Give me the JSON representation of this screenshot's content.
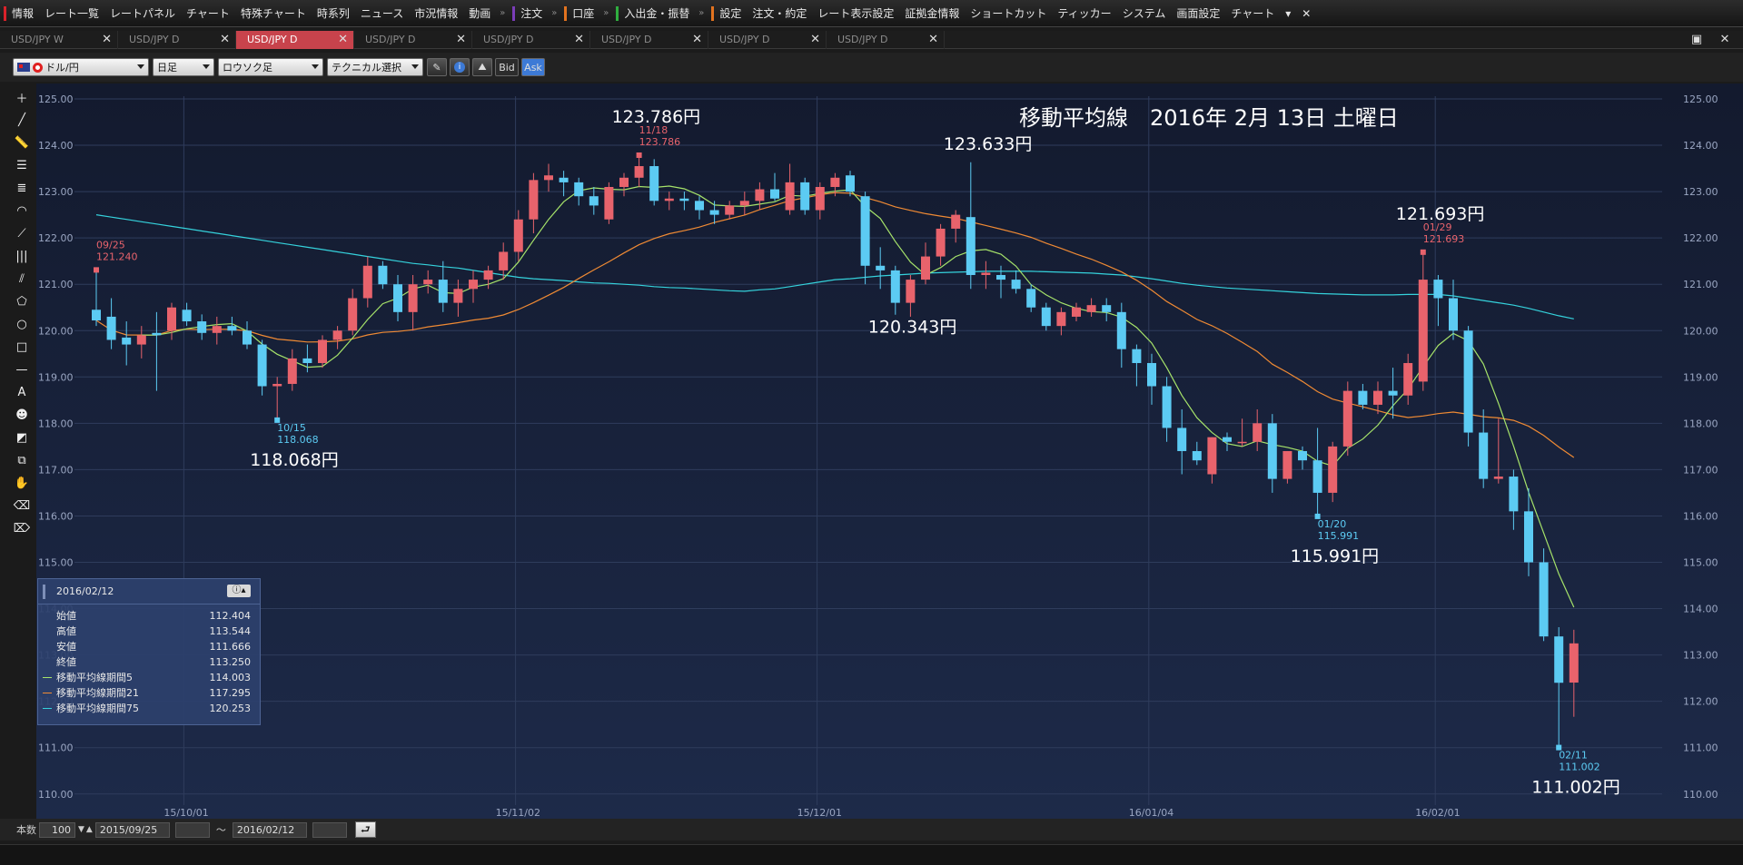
{
  "menu": {
    "groups": [
      {
        "mark": "#d9222a",
        "items": [
          "情報",
          "レート一覧",
          "レートパネル",
          "チャート",
          "特殊チャート",
          "時系列",
          "ニュース",
          "市況情報",
          "動画"
        ]
      },
      {
        "mark": "#7a3db8",
        "items": [
          "注文"
        ]
      },
      {
        "mark": "#e2731f",
        "items": [
          "口座"
        ]
      },
      {
        "mark": "#2fae3f",
        "items": [
          "入出金・振替"
        ]
      },
      {
        "mark": "#e2731f",
        "items": [
          "設定",
          "注文・約定",
          "レート表示設定",
          "証拠金情報",
          "ショートカット",
          "ティッカー",
          "システム",
          "画面設定",
          "チャート"
        ]
      }
    ],
    "more_label": "▾",
    "close_label": "✕"
  },
  "tabs": [
    {
      "label": "USD/JPY W",
      "active": false
    },
    {
      "label": "USD/JPY D",
      "active": false
    },
    {
      "label": "USD/JPY D",
      "active": true
    },
    {
      "label": "USD/JPY D",
      "active": false
    },
    {
      "label": "USD/JPY D",
      "active": false
    },
    {
      "label": "USD/JPY D",
      "active": false
    },
    {
      "label": "USD/JPY D",
      "active": false
    },
    {
      "label": "USD/JPY D",
      "active": false
    }
  ],
  "toolbar": {
    "pair": "ドル/円",
    "timeframe": "日足",
    "chart_style": "ロウソク足",
    "technical": "テクニカル選択",
    "bid_label": "Bid",
    "ask_label": "Ask"
  },
  "footer": {
    "count_label": "本数",
    "count_value": "100",
    "date_from": "2015/09/25",
    "tilde": "～",
    "date_to": "2016/02/12",
    "go_label": "⮐"
  },
  "ohlc": {
    "date": "2016/02/12",
    "rows": [
      {
        "label": "始値",
        "value": "112.404",
        "swatch": ""
      },
      {
        "label": "高値",
        "value": "113.544",
        "swatch": ""
      },
      {
        "label": "安値",
        "value": "111.666",
        "swatch": ""
      },
      {
        "label": "終値",
        "value": "113.250",
        "swatch": ""
      },
      {
        "label": "移動平均線期間5",
        "value": "114.003",
        "swatch": "#a6e36a"
      },
      {
        "label": "移動平均線期間21",
        "value": "117.295",
        "swatch": "#ef8a34"
      },
      {
        "label": "移動平均線期間75",
        "value": "120.253",
        "swatch": "#35d2dc"
      }
    ]
  },
  "chart_data": {
    "type": "candlestick",
    "title": "移動平均線　2016年 2月 13日 土曜日",
    "ylim": [
      110.0,
      125.0
    ],
    "yticks": [
      "125.00",
      "124.00",
      "123.00",
      "122.00",
      "121.00",
      "120.00",
      "119.00",
      "118.00",
      "117.00",
      "116.00",
      "115.00",
      "114.00",
      "113.00",
      "112.00",
      "111.00",
      "110.00"
    ],
    "xticks": [
      {
        "label": "15/10/01",
        "index": 4
      },
      {
        "label": "15/11/02",
        "index": 26
      },
      {
        "label": "15/12/01",
        "index": 46
      },
      {
        "label": "16/01/04",
        "index": 68
      },
      {
        "label": "16/02/01",
        "index": 87
      }
    ],
    "colors": {
      "up": "#e8636c",
      "down": "#5ccbf3",
      "ma5": "#a6e36a",
      "ma21": "#ef8a34",
      "ma75": "#35d2dc"
    },
    "candles": [
      [
        120.45,
        121.31,
        120.1,
        120.22
      ],
      [
        120.3,
        120.7,
        119.6,
        119.8
      ],
      [
        119.85,
        120.2,
        119.25,
        119.7
      ],
      [
        119.7,
        120.1,
        119.4,
        119.9
      ],
      [
        119.95,
        120.4,
        118.7,
        119.9
      ],
      [
        120.0,
        120.6,
        119.8,
        120.5
      ],
      [
        120.45,
        120.6,
        120.1,
        120.2
      ],
      [
        120.2,
        120.35,
        119.8,
        119.95
      ],
      [
        119.95,
        120.3,
        119.7,
        120.1
      ],
      [
        120.1,
        120.3,
        119.9,
        120.0
      ],
      [
        120.0,
        120.2,
        119.6,
        119.7
      ],
      [
        119.7,
        119.8,
        118.6,
        118.8
      ],
      [
        118.8,
        119.0,
        118.068,
        118.85
      ],
      [
        118.85,
        119.6,
        118.7,
        119.4
      ],
      [
        119.4,
        119.7,
        119.1,
        119.3
      ],
      [
        119.3,
        119.9,
        119.2,
        119.8
      ],
      [
        119.8,
        120.1,
        119.6,
        120.0
      ],
      [
        120.0,
        120.9,
        119.9,
        120.7
      ],
      [
        120.7,
        121.6,
        120.5,
        121.4
      ],
      [
        121.4,
        121.5,
        120.9,
        121.0
      ],
      [
        121.0,
        121.2,
        120.2,
        120.4
      ],
      [
        120.4,
        121.2,
        120.0,
        121.0
      ],
      [
        121.0,
        121.3,
        120.8,
        121.1
      ],
      [
        121.1,
        121.5,
        120.4,
        120.6
      ],
      [
        120.6,
        121.1,
        120.3,
        120.9
      ],
      [
        120.9,
        121.3,
        120.6,
        121.1
      ],
      [
        121.1,
        121.4,
        120.9,
        121.3
      ],
      [
        121.3,
        121.9,
        121.1,
        121.7
      ],
      [
        121.7,
        122.6,
        121.5,
        122.4
      ],
      [
        122.4,
        123.4,
        122.1,
        123.25
      ],
      [
        123.25,
        123.6,
        123.0,
        123.35
      ],
      [
        123.3,
        123.45,
        122.9,
        123.2
      ],
      [
        123.2,
        123.3,
        122.7,
        122.9
      ],
      [
        122.9,
        123.1,
        122.5,
        122.7
      ],
      [
        122.4,
        123.2,
        122.3,
        123.1
      ],
      [
        123.1,
        123.4,
        122.9,
        123.3
      ],
      [
        123.3,
        123.786,
        123.1,
        123.55
      ],
      [
        123.55,
        123.7,
        122.7,
        122.8
      ],
      [
        122.8,
        123.0,
        122.6,
        122.85
      ],
      [
        122.85,
        123.0,
        122.6,
        122.8
      ],
      [
        122.8,
        122.9,
        122.4,
        122.6
      ],
      [
        122.6,
        122.8,
        122.3,
        122.5
      ],
      [
        122.5,
        122.8,
        122.4,
        122.7
      ],
      [
        122.7,
        123.0,
        122.5,
        122.8
      ],
      [
        122.8,
        123.2,
        122.6,
        123.05
      ],
      [
        123.05,
        123.4,
        122.8,
        122.85
      ],
      [
        122.6,
        123.6,
        122.5,
        123.2
      ],
      [
        123.2,
        123.3,
        122.5,
        122.6
      ],
      [
        122.6,
        123.2,
        122.4,
        123.1
      ],
      [
        123.1,
        123.4,
        122.9,
        123.3
      ],
      [
        123.35,
        123.45,
        122.9,
        123.0
      ],
      [
        122.9,
        123.0,
        121.0,
        121.4
      ],
      [
        121.4,
        121.8,
        120.9,
        121.3
      ],
      [
        121.3,
        121.4,
        120.343,
        120.6
      ],
      [
        120.6,
        121.2,
        120.3,
        121.1
      ],
      [
        121.1,
        121.9,
        121.0,
        121.6
      ],
      [
        121.6,
        122.3,
        121.4,
        122.2
      ],
      [
        122.2,
        122.6,
        121.9,
        122.5
      ],
      [
        122.45,
        123.633,
        120.9,
        121.2
      ],
      [
        121.2,
        121.5,
        120.9,
        121.25
      ],
      [
        121.2,
        121.4,
        120.7,
        121.1
      ],
      [
        121.1,
        121.3,
        120.8,
        120.9
      ],
      [
        120.9,
        121.0,
        120.4,
        120.5
      ],
      [
        120.5,
        120.6,
        120.0,
        120.1
      ],
      [
        120.1,
        120.5,
        119.9,
        120.4
      ],
      [
        120.3,
        120.6,
        120.2,
        120.5
      ],
      [
        120.4,
        120.7,
        120.3,
        120.55
      ],
      [
        120.55,
        120.7,
        120.2,
        120.4
      ],
      [
        120.4,
        120.6,
        119.2,
        119.6
      ],
      [
        119.6,
        119.7,
        118.8,
        119.3
      ],
      [
        119.3,
        119.5,
        118.4,
        118.8
      ],
      [
        118.8,
        119.0,
        117.6,
        117.9
      ],
      [
        117.9,
        118.3,
        116.9,
        117.4
      ],
      [
        117.4,
        117.6,
        117.1,
        117.2
      ],
      [
        116.9,
        117.7,
        116.7,
        117.7
      ],
      [
        117.7,
        117.8,
        117.4,
        117.6
      ],
      [
        117.6,
        118.1,
        117.5,
        117.6
      ],
      [
        117.6,
        118.3,
        117.4,
        118.0
      ],
      [
        118.0,
        118.2,
        116.5,
        116.8
      ],
      [
        116.8,
        117.4,
        116.7,
        117.4
      ],
      [
        117.4,
        117.5,
        117.0,
        117.2
      ],
      [
        117.2,
        117.9,
        115.991,
        116.5
      ],
      [
        116.5,
        117.6,
        116.3,
        117.5
      ],
      [
        117.5,
        118.9,
        117.3,
        118.7
      ],
      [
        118.7,
        118.85,
        118.3,
        118.4
      ],
      [
        118.4,
        118.9,
        118.2,
        118.7
      ],
      [
        118.7,
        119.2,
        118.1,
        118.6
      ],
      [
        118.6,
        119.5,
        118.4,
        119.3
      ],
      [
        118.9,
        121.693,
        118.7,
        121.1
      ],
      [
        121.1,
        121.2,
        120.1,
        120.7
      ],
      [
        120.7,
        121.1,
        119.8,
        120.0
      ],
      [
        120.0,
        120.1,
        117.5,
        117.8
      ],
      [
        117.8,
        118.3,
        116.6,
        116.8
      ],
      [
        116.8,
        118.1,
        116.7,
        116.85
      ],
      [
        116.85,
        117.0,
        115.7,
        116.1
      ],
      [
        116.1,
        116.6,
        114.7,
        115.0
      ],
      [
        115.0,
        115.3,
        113.3,
        113.4
      ],
      [
        113.4,
        113.6,
        111.002,
        112.4
      ],
      [
        112.404,
        113.544,
        111.666,
        113.25
      ]
    ],
    "ma_ranges": {
      "ma5_start": 8,
      "ma21_start": 0,
      "ma75_start": 0
    },
    "ma75_series": [
      122.5,
      122.45,
      122.4,
      122.35,
      122.3,
      122.25,
      122.2,
      122.15,
      122.1,
      122.05,
      122.0,
      121.95,
      121.9,
      121.85,
      121.8,
      121.75,
      121.7,
      121.65,
      121.6,
      121.55,
      121.5,
      121.45,
      121.42,
      121.38,
      121.35,
      121.3,
      121.25,
      121.2,
      121.15,
      121.12,
      121.1,
      121.08,
      121.05,
      121.03,
      121.02,
      121.0,
      120.98,
      120.95,
      120.93,
      120.92,
      120.9,
      120.88,
      120.86,
      120.85,
      120.88,
      120.9,
      120.95,
      121.0,
      121.05,
      121.1,
      121.12,
      121.15,
      121.18,
      121.2,
      121.22,
      121.24,
      121.25,
      121.26,
      121.27,
      121.28,
      121.28,
      121.28,
      121.28,
      121.27,
      121.26,
      121.25,
      121.24,
      121.22,
      121.2,
      121.16,
      121.12,
      121.07,
      121.02,
      120.98,
      120.95,
      120.92,
      120.9,
      120.88,
      120.86,
      120.84,
      120.82,
      120.8,
      120.79,
      120.78,
      120.77,
      120.77,
      120.77,
      120.78,
      120.78,
      120.78,
      120.75,
      120.7,
      120.65,
      120.6,
      120.55,
      120.48,
      120.4,
      120.32,
      120.253
    ],
    "annotations": [
      {
        "index": 0,
        "price": 121.31,
        "date": "09/25",
        "value": "121.240",
        "big": "",
        "color": "#e8636c",
        "side": "above"
      },
      {
        "index": 12,
        "price": 118.068,
        "date": "10/15",
        "value": "118.068",
        "big": "118.068円",
        "color": "#5ccbf3",
        "side": "below"
      },
      {
        "index": 36,
        "price": 123.786,
        "date": "11/18",
        "value": "123.786",
        "big": "123.786円",
        "color": "#e8636c",
        "side": "above"
      },
      {
        "index": 58,
        "price": 123.633,
        "date": "",
        "value": "",
        "big": "123.633円",
        "color": "#e8636c",
        "side": "above"
      },
      {
        "index": 53,
        "price": 120.343,
        "date": "",
        "value": "",
        "big": "120.343円",
        "color": "#5ccbf3",
        "side": "below"
      },
      {
        "index": 81,
        "price": 115.991,
        "date": "01/20",
        "value": "115.991",
        "big": "115.991円",
        "color": "#5ccbf3",
        "side": "below"
      },
      {
        "index": 88,
        "price": 121.693,
        "date": "01/29",
        "value": "121.693",
        "big": "121.693円",
        "color": "#e8636c",
        "side": "above"
      },
      {
        "index": 97,
        "price": 111.002,
        "date": "02/11",
        "value": "111.002",
        "big": "111.002円",
        "color": "#5ccbf3",
        "side": "below"
      }
    ]
  }
}
